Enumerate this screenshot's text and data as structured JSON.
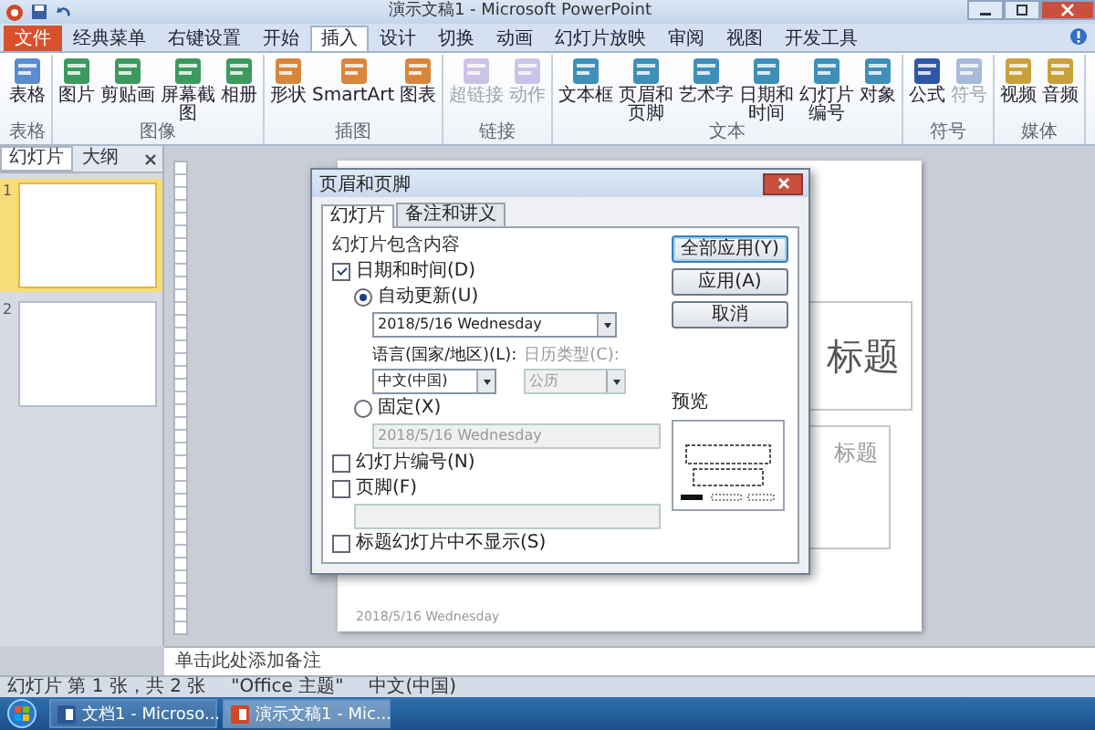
{
  "window": {
    "title": "演示文稿1 - Microsoft PowerPoint"
  },
  "ribbon_tabs": [
    {
      "label": "文件",
      "selected": false,
      "kind": "file"
    },
    {
      "label": "经典菜单",
      "selected": false,
      "kind": "tab"
    },
    {
      "label": "右键设置",
      "selected": false,
      "kind": "tab"
    },
    {
      "label": "开始",
      "selected": false,
      "kind": "tab"
    },
    {
      "label": "插入",
      "selected": true,
      "kind": "tab"
    },
    {
      "label": "设计",
      "selected": false,
      "kind": "tab"
    },
    {
      "label": "切换",
      "selected": false,
      "kind": "tab"
    },
    {
      "label": "动画",
      "selected": false,
      "kind": "tab"
    },
    {
      "label": "幻灯片放映",
      "selected": false,
      "kind": "tab"
    },
    {
      "label": "审阅",
      "selected": false,
      "kind": "tab"
    },
    {
      "label": "视图",
      "selected": false,
      "kind": "tab"
    },
    {
      "label": "开发工具",
      "selected": false,
      "kind": "tab"
    }
  ],
  "ribbon_groups": [
    {
      "label": "表格",
      "buttons": [
        {
          "label": "表格",
          "disabled": false
        }
      ]
    },
    {
      "label": "图像",
      "buttons": [
        {
          "label": "图片",
          "disabled": false
        },
        {
          "label": "剪贴画",
          "disabled": false
        },
        {
          "label": "屏幕截图",
          "disabled": false
        },
        {
          "label": "相册",
          "disabled": false
        }
      ]
    },
    {
      "label": "插图",
      "buttons": [
        {
          "label": "形状",
          "disabled": false
        },
        {
          "label": "SmartArt",
          "disabled": false
        },
        {
          "label": "图表",
          "disabled": false
        }
      ]
    },
    {
      "label": "链接",
      "buttons": [
        {
          "label": "超链接",
          "disabled": true
        },
        {
          "label": "动作",
          "disabled": true
        }
      ]
    },
    {
      "label": "文本",
      "buttons": [
        {
          "label": "文本框",
          "disabled": false
        },
        {
          "label": "页眉和页脚",
          "disabled": false
        },
        {
          "label": "艺术字",
          "disabled": false
        },
        {
          "label": "日期和时间",
          "disabled": false
        },
        {
          "label": "幻灯片编号",
          "disabled": false
        },
        {
          "label": "对象",
          "disabled": false
        }
      ]
    },
    {
      "label": "符号",
      "buttons": [
        {
          "label": "公式",
          "disabled": false
        },
        {
          "label": "符号",
          "disabled": true
        }
      ]
    },
    {
      "label": "媒体",
      "buttons": [
        {
          "label": "视频",
          "disabled": false
        },
        {
          "label": "音频",
          "disabled": false
        }
      ]
    }
  ],
  "pane_tabs": [
    {
      "label": "幻灯片",
      "selected": true
    },
    {
      "label": "大纲",
      "selected": false
    }
  ],
  "thumbnails": [
    {
      "number": "1",
      "selected": true
    },
    {
      "number": "2",
      "selected": false
    }
  ],
  "slide": {
    "title": "标题",
    "subtitle": "标题",
    "footer": "2018/5/16 Wednesday"
  },
  "dialog": {
    "title": "页眉和页脚",
    "tabs": [
      {
        "label": "幻灯片",
        "selected": true
      },
      {
        "label": "备注和讲义",
        "selected": false
      }
    ],
    "section": "幻灯片包含内容",
    "date_time": {
      "label": "日期和时间(D)",
      "checked": true
    },
    "auto_update": {
      "label": "自动更新(U)",
      "selected": true,
      "value": "2018/5/16 Wednesday"
    },
    "language": {
      "label": "语言(国家/地区)(L):",
      "value": "中文(中国)"
    },
    "calendar": {
      "label": "日历类型(C):",
      "value": "公历",
      "disabled": true
    },
    "fixed": {
      "label": "固定(X)",
      "selected": false,
      "value": "2018/5/16 Wednesday"
    },
    "slide_number": {
      "label": "幻灯片编号(N)",
      "checked": false
    },
    "footer": {
      "label": "页脚(F)",
      "checked": false
    },
    "hide_on_title": {
      "label": "标题幻灯片中不显示(S)",
      "checked": false
    },
    "buttons": [
      {
        "label": "全部应用(Y)",
        "default": true
      },
      {
        "label": "应用(A)",
        "default": false
      },
      {
        "label": "取消",
        "default": false
      }
    ],
    "preview": {
      "label": "预览"
    }
  },
  "notes": {
    "placeholder": "单击此处添加备注"
  },
  "status_bar": {
    "slide_info": "幻灯片 第 1 张，共 2 张",
    "theme": "\"Office 主题\"",
    "language": "中文(中国)"
  },
  "taskbar": [
    {
      "label": "文档1 - Microso...",
      "kind": "word",
      "selected": false
    },
    {
      "label": "演示文稿1 - Mic...",
      "kind": "powerpoint",
      "selected": true
    }
  ]
}
